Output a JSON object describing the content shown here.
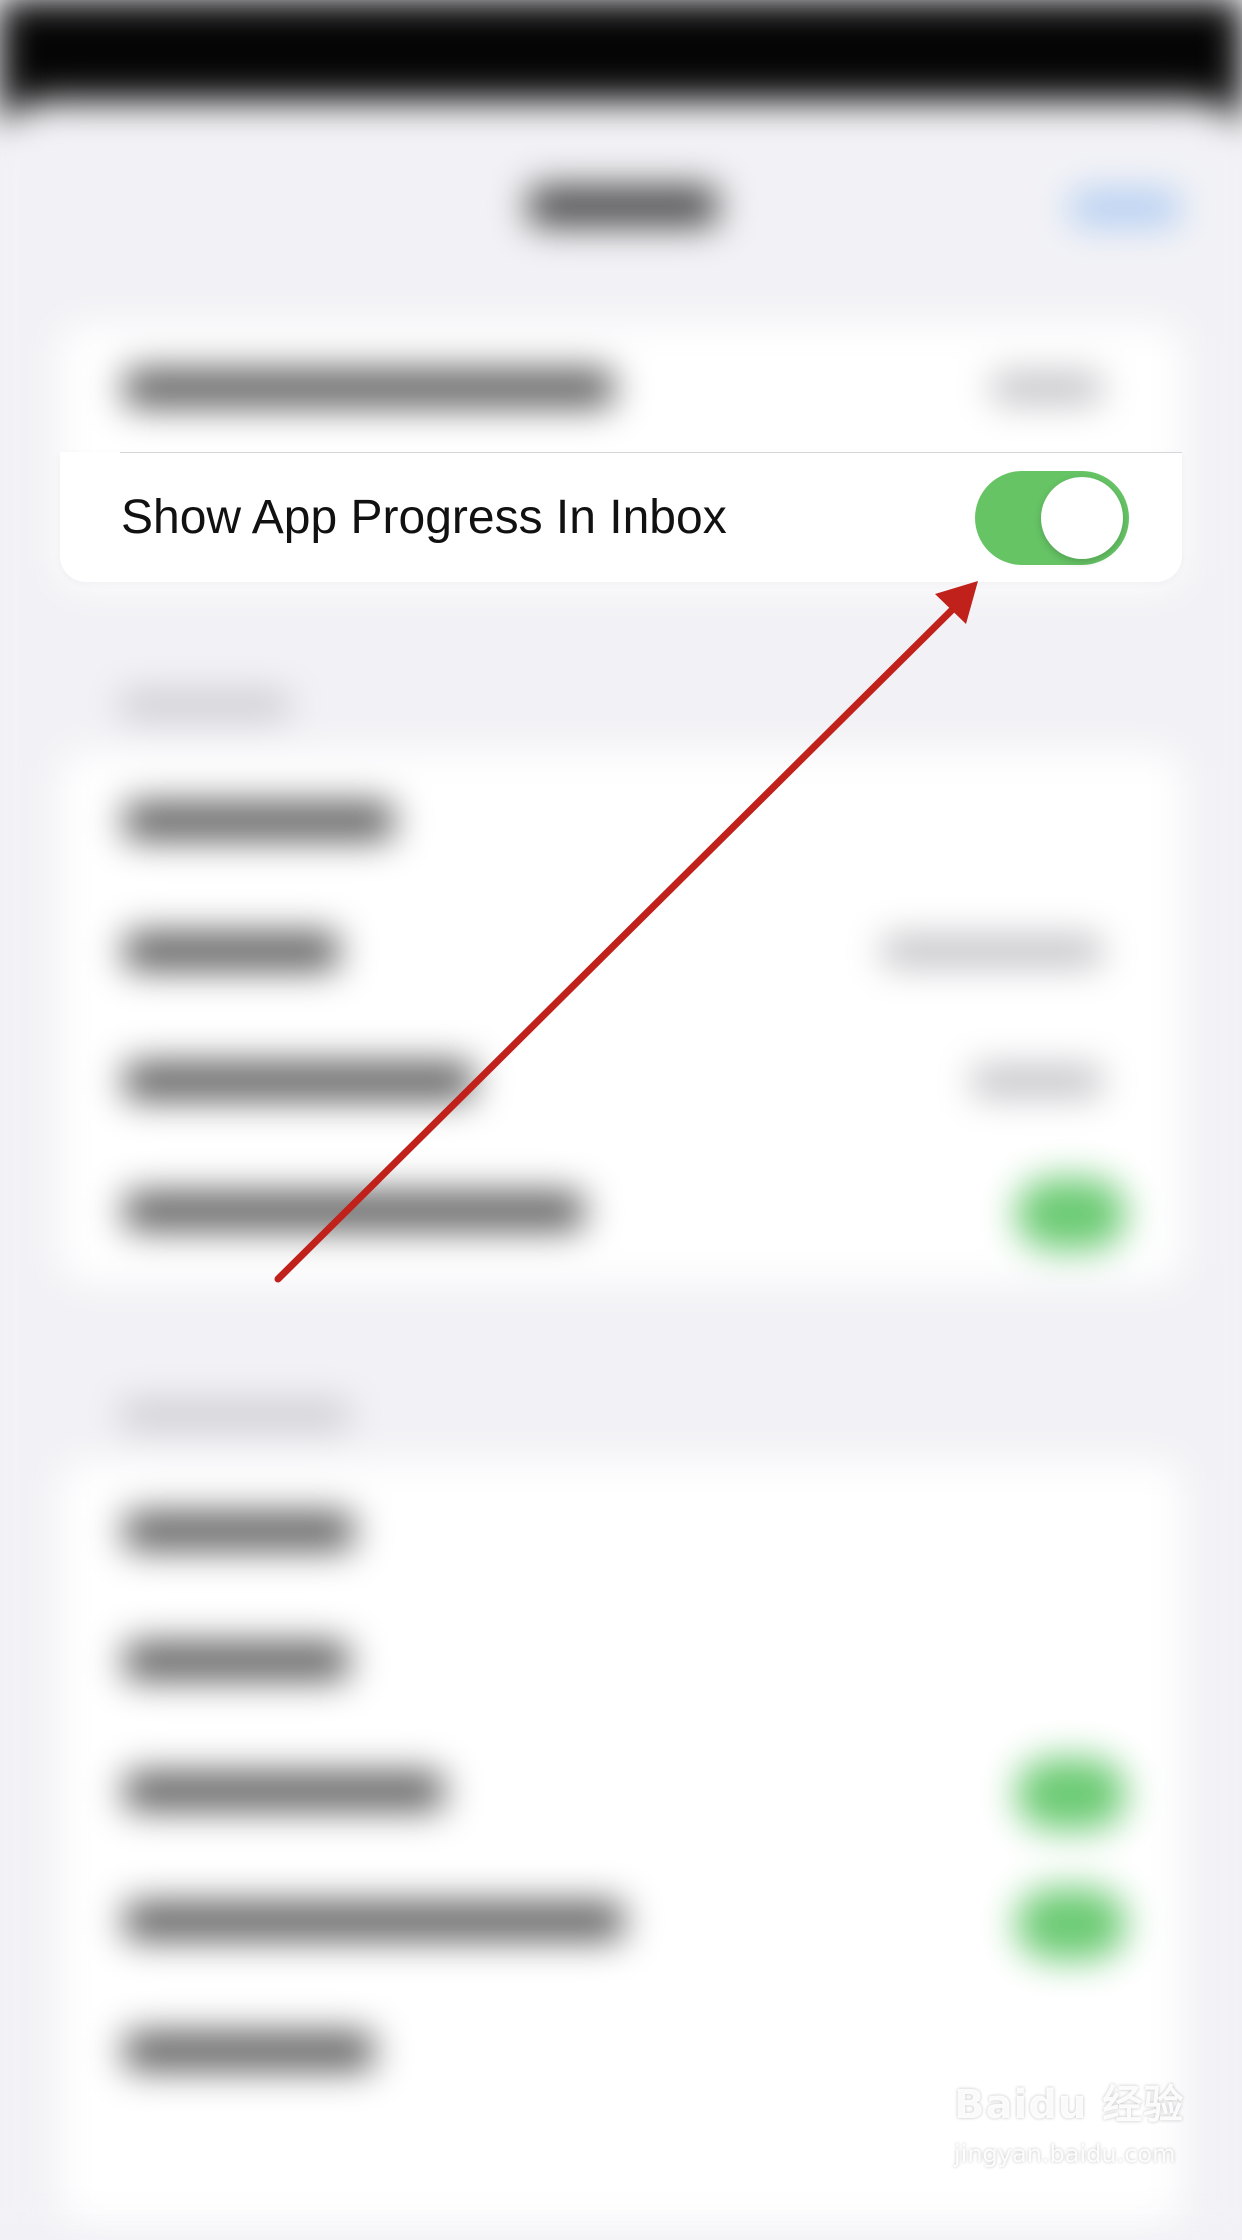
{
  "settings_row": {
    "label": "Show App Progress In Inbox",
    "toggle_on": true
  },
  "colors": {
    "toggle_on": "#66c465",
    "arrow": "#c0211b",
    "background": "#f2f2f6"
  },
  "watermark": {
    "brand": "Baidu 经验",
    "site": "jingyan.baidu.com"
  }
}
